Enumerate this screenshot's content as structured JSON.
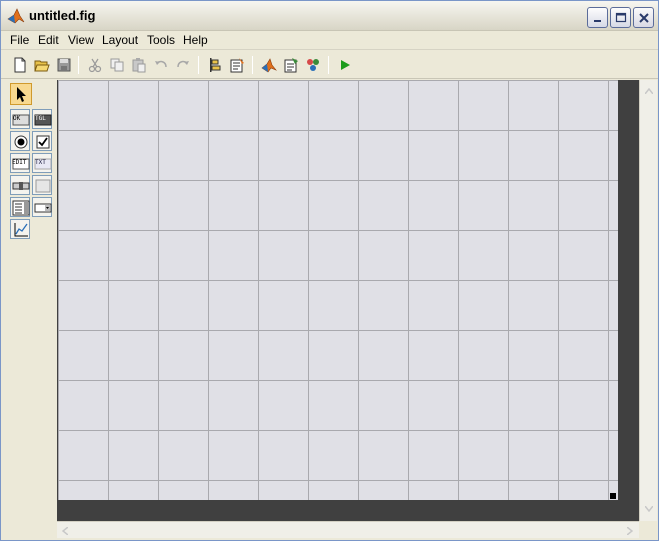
{
  "window": {
    "title": "untitled.fig"
  },
  "menu": [
    "File",
    "Edit",
    "View",
    "Layout",
    "Tools",
    "Help"
  ],
  "toolbar": {
    "buttons": [
      "new-icon",
      "open-icon",
      "save-icon",
      "cut-icon",
      "copy-icon",
      "paste-icon",
      "undo-icon",
      "redo-icon",
      "align-objects-icon",
      "menu-editor-icon",
      "tab-order-editor-icon",
      "mfile-editor-icon",
      "property-inspector-icon",
      "object-browser-icon",
      "run-icon"
    ]
  },
  "palette": {
    "push_button": "OK",
    "toggle_button": "TGL",
    "edit_text": "EDIT",
    "static_text": "TXT"
  },
  "colors": {
    "canvas_bg": "#e0e0e6",
    "grid_line": "#a9a9ae",
    "run_green": "#1c9c1c",
    "matlab_orange": "#e0701c"
  }
}
